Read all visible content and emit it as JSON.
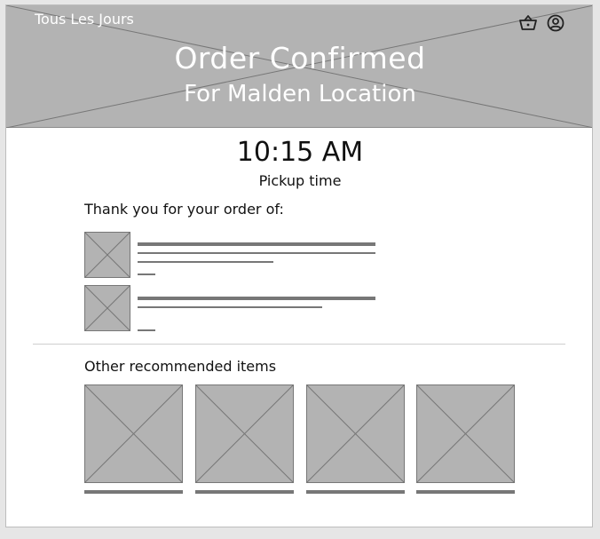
{
  "header": {
    "brand": "Tous Les Jours",
    "title": "Order Confirmed",
    "subtitle": "For Malden Location",
    "icons": [
      "basket-icon",
      "user-account-icon"
    ]
  },
  "pickup": {
    "time": "10:15 AM",
    "label": "Pickup time"
  },
  "order": {
    "intro": "Thank you for your order of:",
    "items": [
      {
        "name": "order-item-1",
        "image": "image-placeholder"
      },
      {
        "name": "order-item-2",
        "image": "image-placeholder"
      }
    ]
  },
  "recommended": {
    "heading": "Other recommended items",
    "items": [
      {
        "image": "image-placeholder"
      },
      {
        "image": "image-placeholder"
      },
      {
        "image": "image-placeholder"
      },
      {
        "image": "image-placeholder"
      }
    ]
  },
  "colors": {
    "placeholder_fill": "#b3b3b3",
    "placeholder_line": "#777777",
    "background": "#e6e6e6"
  }
}
